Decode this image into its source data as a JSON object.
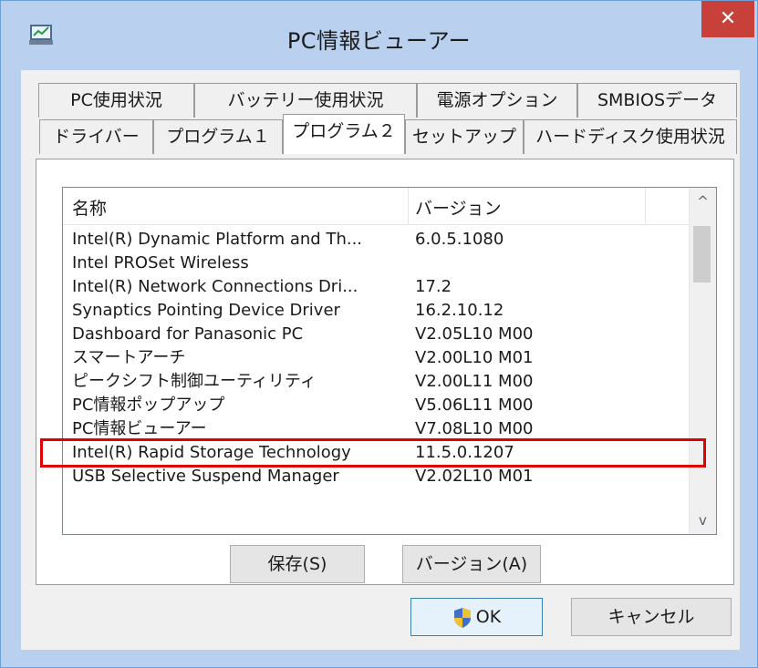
{
  "window": {
    "title": "PC情報ビューアー",
    "close_label": "✕"
  },
  "tabs": {
    "row1": [
      "PC使用状況",
      "バッテリー使用状況",
      "電源オプション",
      "SMBIOSデータ"
    ],
    "row2": [
      "ドライバー",
      "プログラム１",
      "プログラム２",
      "セットアップ",
      "ハードディスク使用状況"
    ],
    "active": "プログラム２"
  },
  "list": {
    "columns": [
      "名称",
      "バージョン"
    ],
    "rows": [
      {
        "name": "Intel(R) Dynamic Platform and Th...",
        "version": "6.0.5.1080"
      },
      {
        "name": "Intel PROSet Wireless",
        "version": ""
      },
      {
        "name": "Intel(R) Network Connections Dri...",
        "version": "17.2"
      },
      {
        "name": "Synaptics Pointing Device Driver",
        "version": "16.2.10.12"
      },
      {
        "name": "Dashboard for Panasonic PC",
        "version": "V2.05L10 M00"
      },
      {
        "name": "スマートアーチ",
        "version": "V2.00L10 M01"
      },
      {
        "name": "ピークシフト制御ユーティリティ",
        "version": "V2.00L11 M00"
      },
      {
        "name": "PC情報ポップアップ",
        "version": "V5.06L11 M00"
      },
      {
        "name": "PC情報ビューアー",
        "version": "V7.08L10 M00"
      },
      {
        "name": "Intel(R) Rapid Storage Technology",
        "version": "11.5.0.1207"
      },
      {
        "name": "USB Selective Suspend Manager",
        "version": "V2.02L10 M01"
      }
    ],
    "scroll_up": "^",
    "scroll_down": "v"
  },
  "buttons": {
    "save": "保存(S)",
    "version": "バージョン(A)",
    "ok": "OK",
    "cancel": "キャンセル"
  },
  "colors": {
    "highlight": "#e00000",
    "close": "#c7403a",
    "frame": "#b9d1ee"
  }
}
